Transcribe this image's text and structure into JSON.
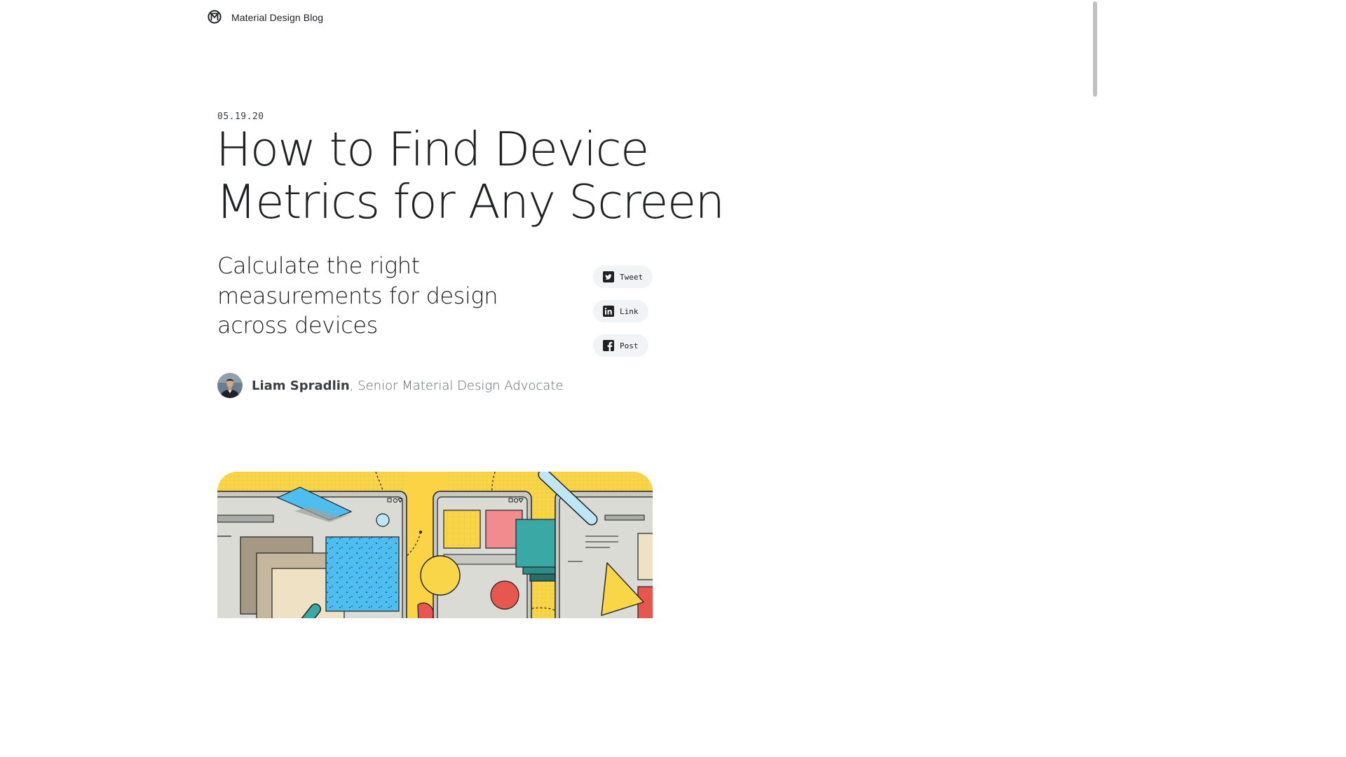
{
  "header": {
    "site_title": "Material Design Blog",
    "logo_icon": "material-logo-icon"
  },
  "post": {
    "date": "05.19.20",
    "title_lines": [
      "How to Find Device",
      "Metrics for Any Screen"
    ],
    "subtitle": "Calculate the right measurements for design across devices"
  },
  "share": {
    "tweet": {
      "label": "Tweet",
      "icon": "twitter-icon"
    },
    "link": {
      "label": "Link",
      "icon": "linkedin-icon"
    },
    "post": {
      "label": "Post",
      "icon": "facebook-icon"
    }
  },
  "author": {
    "name": "Liam Spradlin",
    "role": ", Senior Material Design Advocate",
    "avatar_icon": "author-avatar"
  },
  "hero": {
    "icon": "hero-illustration",
    "colors": {
      "background": "#f9d548",
      "device": "#dadbd5",
      "teal": "#3aa9a6",
      "blue": "#4ebdf0",
      "pink": "#f28b8d",
      "red": "#e8574f",
      "yellow": "#f9d548",
      "tan": "#a69984"
    }
  },
  "colors": {
    "text": "#202124",
    "muted": "#5f6368",
    "chip_bg": "#f1f3f4",
    "scrollbar_thumb": "#c1c1c1"
  }
}
